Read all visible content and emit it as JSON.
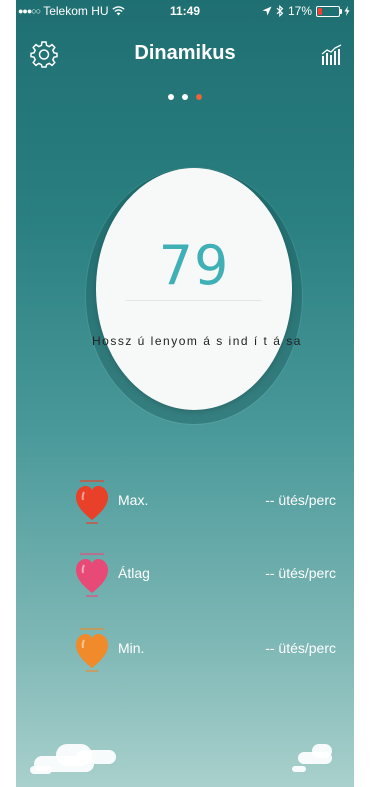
{
  "status_bar": {
    "carrier": "Telekom HU",
    "time": "11:49",
    "battery": "17%"
  },
  "header": {
    "title": "Dinamikus"
  },
  "pager": {
    "count": 3,
    "active_index": 2
  },
  "measure": {
    "bpm": "79",
    "hint": "Hossz ú lenyom á s ind í t á sa"
  },
  "stats": [
    {
      "label": "Max.",
      "value": "-- ütés/perc",
      "color": "#e9402a"
    },
    {
      "label": "Átlag",
      "value": "-- ütés/perc",
      "color": "#e84a78"
    },
    {
      "label": "Min.",
      "value": "-- ütés/perc",
      "color": "#f08a2a"
    }
  ],
  "colors": {
    "accent": "#3fb0b6",
    "active_dot": "#e8643a"
  }
}
